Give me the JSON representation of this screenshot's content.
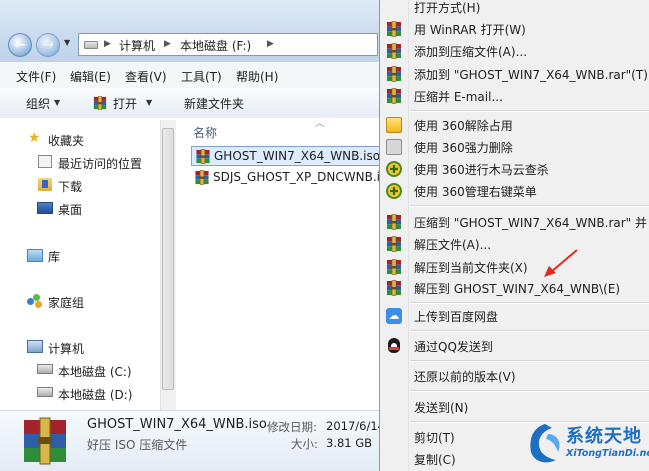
{
  "address": {
    "crumbs": [
      "计算机",
      "本地磁盘 (F:)"
    ]
  },
  "menubar": [
    "文件(F)",
    "编辑(E)",
    "查看(V)",
    "工具(T)",
    "帮助(H)"
  ],
  "toolbar": {
    "organize": "组织",
    "open": "打开",
    "new_folder": "新建文件夹"
  },
  "navpane": {
    "favorites": "收藏夹",
    "recent": "最近访问的位置",
    "downloads": "下载",
    "desktop": "桌面",
    "library": "库",
    "homegroup": "家庭组",
    "computer": "计算机",
    "drive_c": "本地磁盘 (C:)",
    "drive_d": "本地磁盘 (D:)"
  },
  "filelist": {
    "column_name": "名称",
    "files": [
      "GHOST_WIN7_X64_WNB.iso",
      "SDJS_GHOST_XP_DNCWNB.i"
    ]
  },
  "details": {
    "name": "GHOST_WIN7_X64_WNB.iso",
    "type": "好压 ISO 压缩文件",
    "modified_label": "修改日期:",
    "modified_value": "2017/6/14",
    "size_label": "大小:",
    "size_value": "3.81 GB"
  },
  "context_menu": {
    "open_with": "打开方式(H)",
    "winrar_open": "用 WinRAR 打开(W)",
    "add_archive": "添加到压缩文件(A)...",
    "add_to_rar": "添加到 \"GHOST_WIN7_X64_WNB.rar\"(T)",
    "compress_email": "压缩并 E-mail...",
    "unlock_360": "使用 360解除占用",
    "force_delete_360": "使用 360强力删除",
    "trojan_scan_360": "使用 360进行木马云查杀",
    "menu_manage_360": "使用 360管理右键菜单",
    "compress_to_rar_email": "压缩到 \"GHOST_WIN7_X64_WNB.rar\" 并 E",
    "extract_files": "解压文件(A)...",
    "extract_here": "解压到当前文件夹(X)",
    "extract_to_folder": "解压到 GHOST_WIN7_X64_WNB\\(E)",
    "upload_baidu": "上传到百度网盘",
    "send_qq": "通过QQ发送到",
    "restore_versions": "还原以前的版本(V)",
    "send_to": "发送到(N)",
    "cut": "剪切(T)",
    "copy": "复制(C)"
  },
  "watermark": {
    "title": "系统天地",
    "url": "XiTongTianDi.net"
  },
  "colors": {
    "rar_red": "#a3232a",
    "rar_blue": "#2f5ea8",
    "rar_green": "#2f8d3a",
    "accent": "#1d6fc4",
    "arrow_red": "#e22b25"
  }
}
